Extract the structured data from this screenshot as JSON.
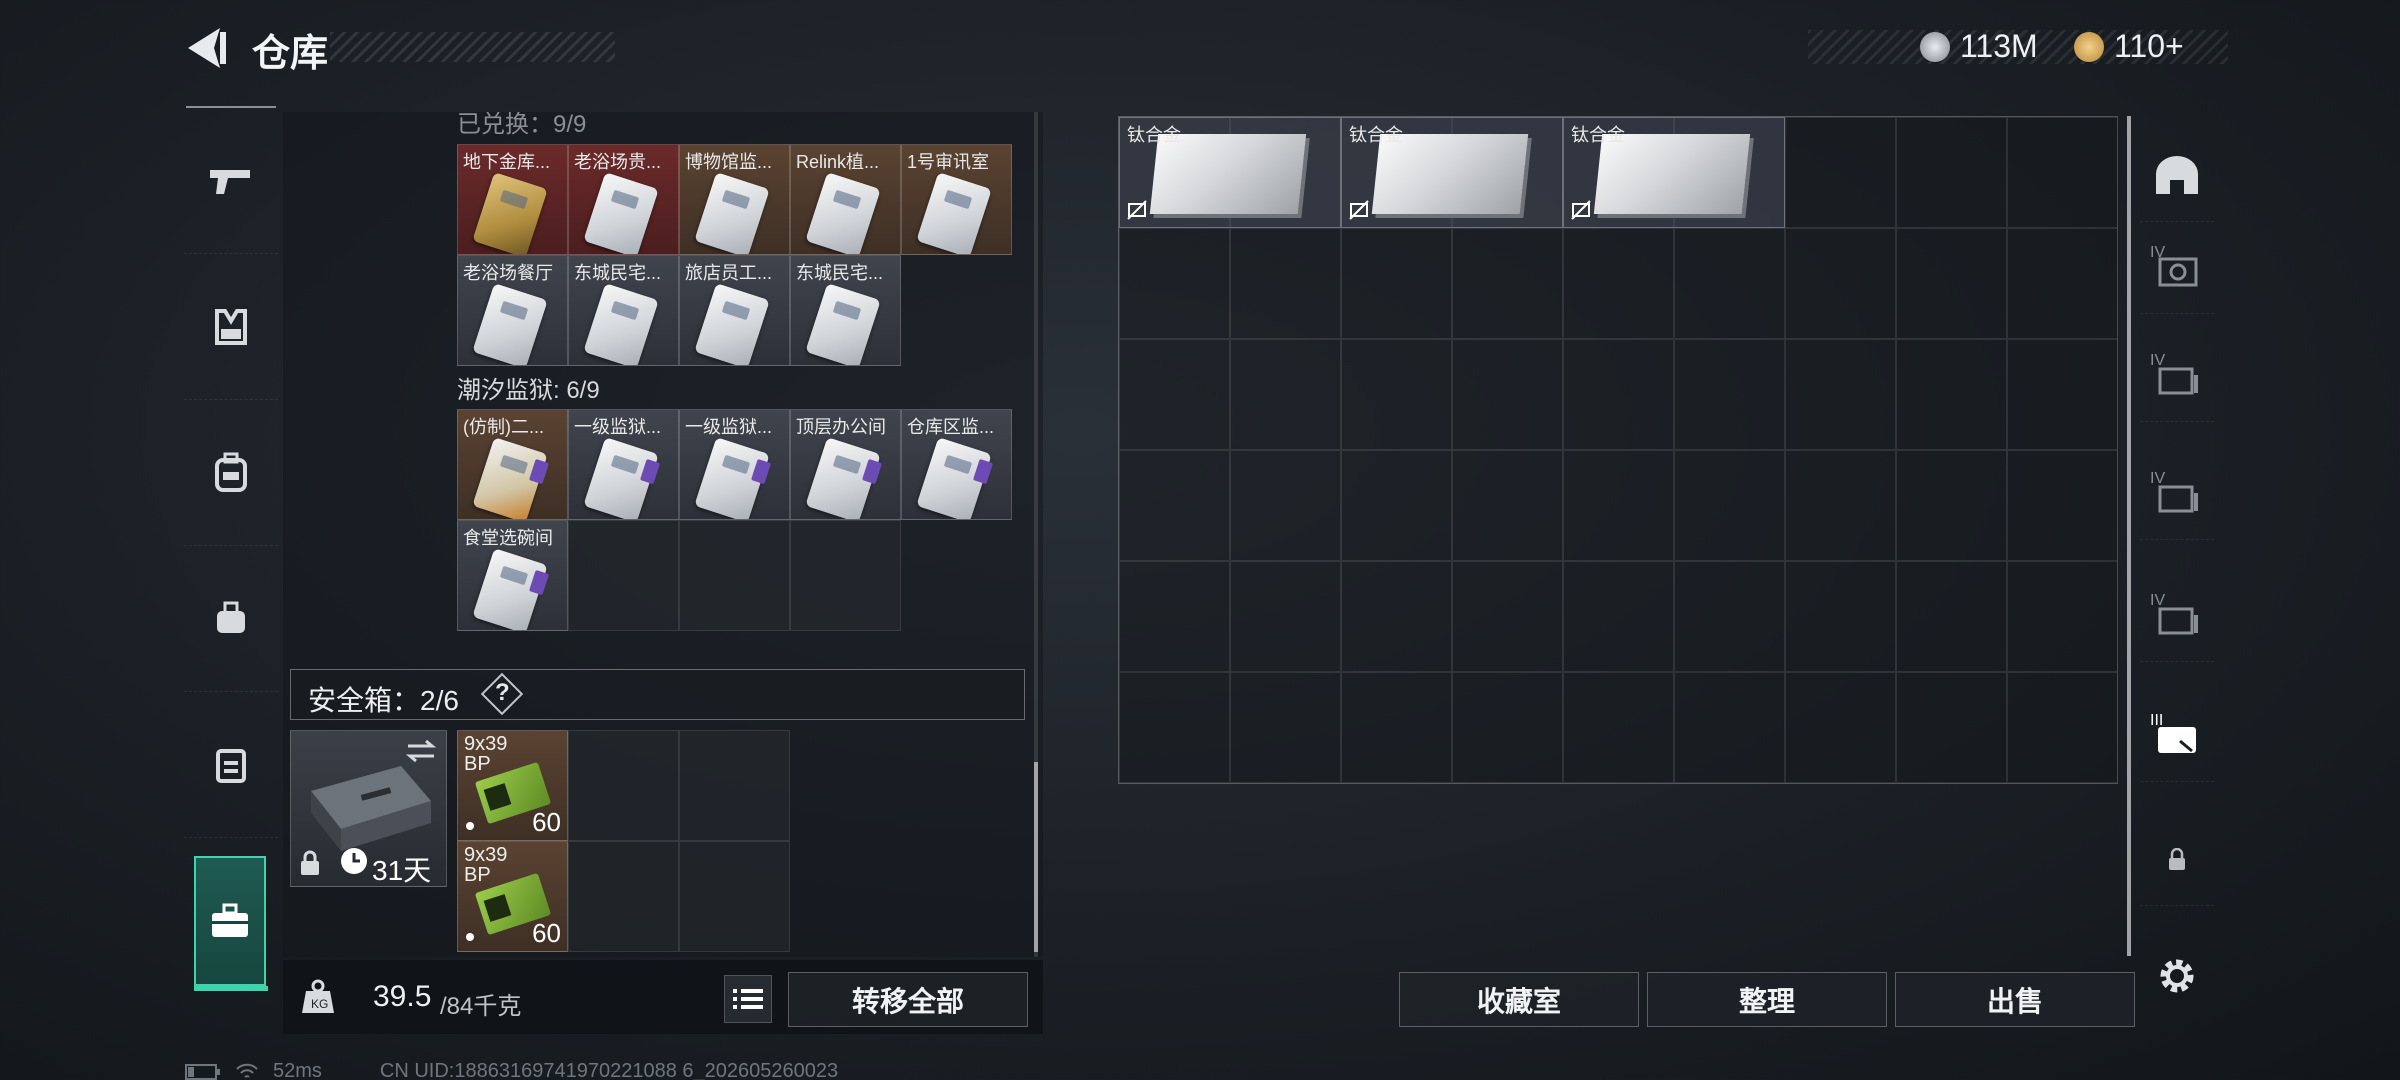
{
  "header": {
    "title": "仓库",
    "currency_silver": "113M",
    "currency_gold": "110+"
  },
  "stash": {
    "section1_title": "已兑换：9/9",
    "section1_row1": [
      "地下金库...",
      "老浴场贵...",
      "博物馆监...",
      "Relink植...",
      "1号审讯室"
    ],
    "section1_row2": [
      "老浴场餐厅",
      "东城民宅...",
      "旅店员工...",
      "东城民宅..."
    ],
    "section2_title": "潮汐监狱: 6/9",
    "section2_row1": [
      "(仿制)二...",
      "一级监狱...",
      "一级监狱...",
      "顶层办公间",
      "仓库区监..."
    ],
    "section2_row2": [
      "食堂选碗间"
    ]
  },
  "safe_box": {
    "label": "安全箱：2/6",
    "help": "?",
    "days": "31天",
    "ammo": [
      {
        "line1": "9x39",
        "line2": "BP",
        "count": "60"
      },
      {
        "line1": "9x39",
        "line2": "BP",
        "count": "60"
      }
    ]
  },
  "bottom_left": {
    "weight_current": "39.5",
    "weight_max": "/84千克",
    "transfer_all": "转移全部"
  },
  "grid": {
    "items": [
      "钛合金",
      "钛合金",
      "钛合金"
    ]
  },
  "buttons": {
    "collection": "收藏室",
    "sort": "整理",
    "sell": "出售"
  },
  "footer": {
    "ping": "52ms",
    "uid": "CN UID:18863169741970221088 6_202605260023"
  },
  "colors": {
    "accent": "#3dd3ad",
    "red_card": "#6b2a2a",
    "brown_card": "#5a4332"
  }
}
